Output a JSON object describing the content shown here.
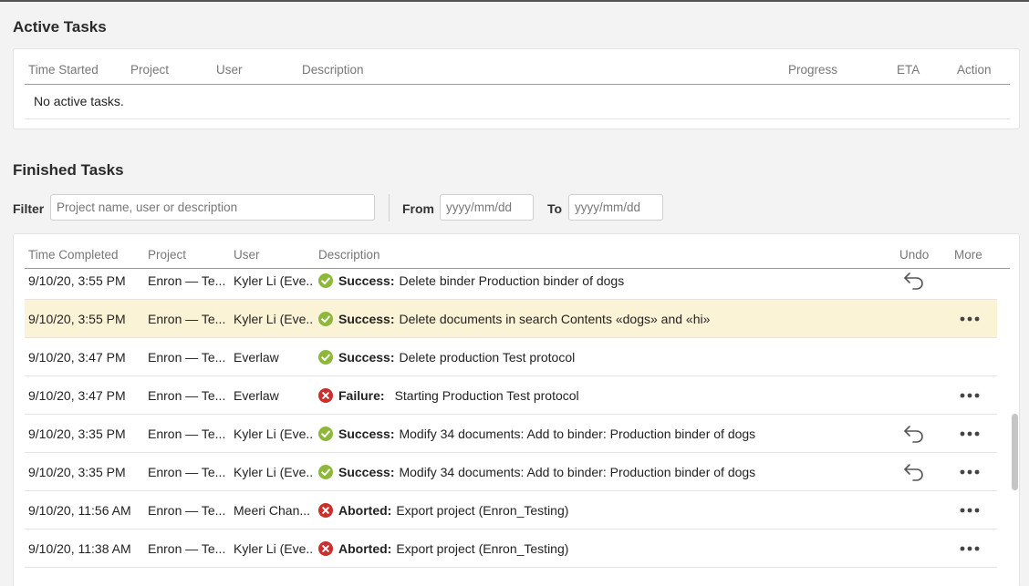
{
  "active": {
    "title": "Active Tasks",
    "columns": [
      "Time Started",
      "Project",
      "User",
      "Description",
      "Progress",
      "ETA",
      "Action"
    ],
    "empty_message": "No active tasks."
  },
  "finished": {
    "title": "Finished Tasks",
    "filter_label": "Filter",
    "filter_placeholder": "Project name, user or description",
    "from_label": "From",
    "from_placeholder": "yyyy/mm/dd",
    "to_label": "To",
    "to_placeholder": "yyyy/mm/dd",
    "columns": [
      "Time Completed",
      "Project",
      "User",
      "Description",
      "Undo",
      "More"
    ],
    "rows": [
      {
        "time": "9/10/20, 3:55 PM",
        "project": "Enron — Te...",
        "user": "Kyler Li (Eve...",
        "status": "success",
        "status_label": "Success:",
        "description": "Delete binder Production binder of dogs",
        "undo": true,
        "more": false,
        "highlight": false
      },
      {
        "time": "9/10/20, 3:55 PM",
        "project": "Enron — Te...",
        "user": "Kyler Li (Eve...",
        "status": "success",
        "status_label": "Success:",
        "description": "Delete documents in search Contents «dogs» and «hi»",
        "undo": false,
        "more": true,
        "highlight": true
      },
      {
        "time": "9/10/20, 3:47 PM",
        "project": "Enron — Te...",
        "user": "Everlaw",
        "status": "success",
        "status_label": "Success:",
        "description": "Delete production Test protocol",
        "undo": false,
        "more": false,
        "highlight": false
      },
      {
        "time": "9/10/20, 3:47 PM",
        "project": "Enron — Te...",
        "user": "Everlaw",
        "status": "failure",
        "status_label": "Failure:",
        "description": "Starting Production Test protocol",
        "undo": false,
        "more": true,
        "highlight": false
      },
      {
        "time": "9/10/20, 3:35 PM",
        "project": "Enron — Te...",
        "user": "Kyler Li (Eve...",
        "status": "success",
        "status_label": "Success:",
        "description": "Modify 34 documents: Add to binder: Production binder of dogs",
        "undo": true,
        "more": true,
        "highlight": false
      },
      {
        "time": "9/10/20, 3:35 PM",
        "project": "Enron — Te...",
        "user": "Kyler Li (Eve...",
        "status": "success",
        "status_label": "Success:",
        "description": "Modify 34 documents: Add to binder: Production binder of dogs",
        "undo": true,
        "more": true,
        "highlight": false
      },
      {
        "time": "9/10/20, 11:56 AM",
        "project": "Enron — Te...",
        "user": "Meeri Chan...",
        "status": "aborted",
        "status_label": "Aborted:",
        "description": "Export project (Enron_Testing)",
        "undo": false,
        "more": true,
        "highlight": false
      },
      {
        "time": "9/10/20, 11:38 AM",
        "project": "Enron — Te...",
        "user": "Kyler Li (Eve...",
        "status": "aborted",
        "status_label": "Aborted:",
        "description": "Export project (Enron_Testing)",
        "undo": false,
        "more": true,
        "highlight": false
      }
    ]
  },
  "colors": {
    "success": "#8db83c",
    "failure": "#c9302c",
    "highlight": "#fbf3d6"
  },
  "icons": {
    "success": "check-circle-icon",
    "failure": "x-circle-icon",
    "aborted": "x-circle-icon",
    "undo": "undo-arrow-icon",
    "more": "ellipsis-icon"
  }
}
